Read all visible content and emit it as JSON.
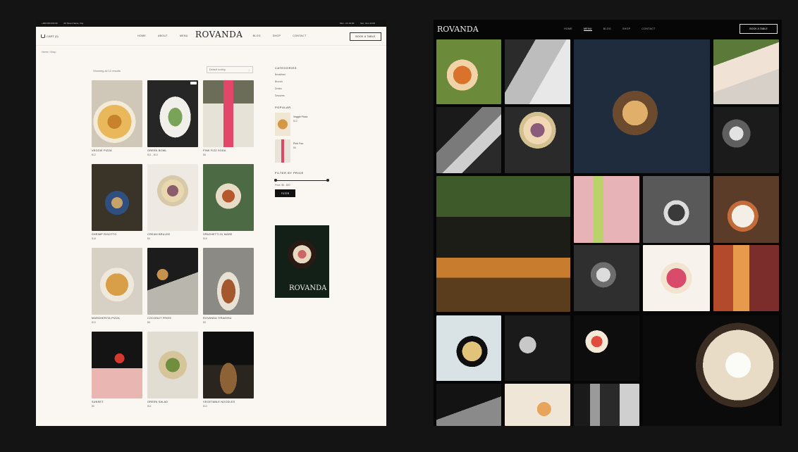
{
  "shop": {
    "topbar": {
      "left": [
        "+000 000 000 00",
        "00 Street Name, City"
      ],
      "right": [
        "Mon - Fri 10:00",
        "Sat - Sun 12:00"
      ]
    },
    "nav": {
      "cart_label": "CART (0)",
      "links": [
        "HOME",
        "ABOUT",
        "MENU",
        "BLOG",
        "SHOP",
        "CONTACT"
      ],
      "logo": "ROVANDA",
      "order_button": "BOOK A TABLE"
    },
    "breadcrumb": "Home  /  Shop",
    "results_text": "Showing all 12 results",
    "sort_select": "Default sorting",
    "products": [
      {
        "name": "VEGGIE PIZZA",
        "price": "$12"
      },
      {
        "name": "GREEN BOWL",
        "price": "$11 - $13"
      },
      {
        "name": "PINK FIZZ SODA",
        "price": "$6"
      },
      {
        "name": "SHRIMP RISOTTO",
        "price": "$18"
      },
      {
        "name": "CREAM BRULEE",
        "price": "$9"
      },
      {
        "name": "SPAGHETTI DI MARE",
        "price": "$16"
      },
      {
        "name": "MARGHERITA PIZZA",
        "price": "$10"
      },
      {
        "name": "COCONUT FRIES",
        "price": "$8"
      },
      {
        "name": "ROVANDA TIRAMISU",
        "price": "$9"
      },
      {
        "name": "SUNSET",
        "price": "$9"
      },
      {
        "name": "GREEN SALAD",
        "price": "$11"
      },
      {
        "name": "VEGETABLE NOODLES",
        "price": "$13"
      }
    ],
    "sidebar": {
      "categories_title": "CATEGORIES",
      "categories": [
        "Breakfast",
        "Brunch",
        "Drinks",
        "Desserts"
      ],
      "popular_title": "POPULAR",
      "popular": [
        {
          "name": "Veggie Pizza",
          "price": "$12"
        },
        {
          "name": "Pink Fizz",
          "price": "$6"
        }
      ],
      "filter_title": "FILTER BY PRICE",
      "price_range": "Price: $5 - $20",
      "filter_button": "FILTER",
      "banner_logo": "ROVANDA"
    }
  },
  "gallery": {
    "nav": {
      "logo": "ROVANDA",
      "links": [
        "HOME",
        "MENU",
        "BLOG",
        "SHOP",
        "CONTACT"
      ],
      "active_link": "MENU",
      "order_button": "BOOK A TABLE"
    },
    "photos": [
      "cocktail",
      "couple-bw",
      "sushi-board",
      "woman-eating",
      "bartender-bw",
      "cream-dessert",
      "crystal-glass-bw",
      "terrace",
      "green-drink",
      "bowl-bw",
      "chef-plating",
      "glasses-bw",
      "berry-cake",
      "whiskey-drinks",
      "noodles-bowl",
      "pastry-bw",
      "strawberry-cocktail",
      "flower-cake",
      "hands-bw",
      "tart-plates",
      "women-bw",
      "pink-berries"
    ]
  },
  "colors": {
    "page_bg": "#141414",
    "shop_bg": "#faf7f2",
    "gallery_bg": "#060606",
    "accent": "#111111"
  }
}
